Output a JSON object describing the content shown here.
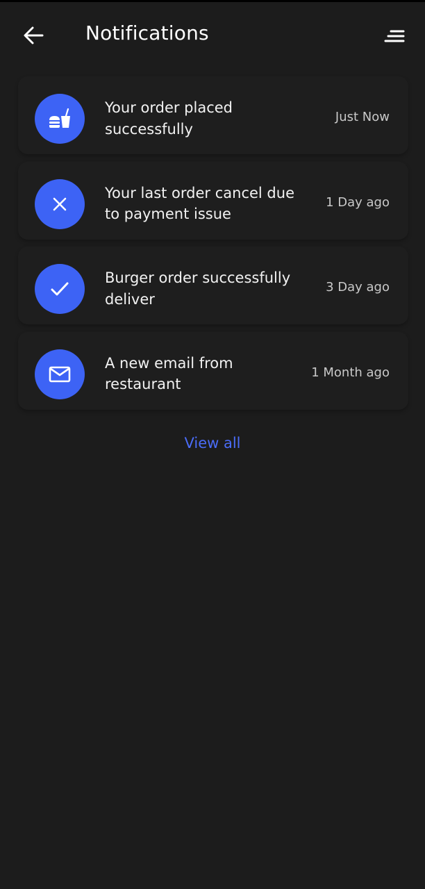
{
  "header": {
    "title": "Notifications",
    "back_icon": "arrow-left-icon",
    "filter_icon": "filter-lines-icon"
  },
  "notifications": [
    {
      "icon": "food-drink-icon",
      "message": "Your order placed successfully",
      "time": "Just Now"
    },
    {
      "icon": "close-icon",
      "message": "Your last order cancel due to payment issue",
      "time": "1 Day ago"
    },
    {
      "icon": "check-icon",
      "message": "Burger order successfully deliver",
      "time": "3 Day ago"
    },
    {
      "icon": "mail-icon",
      "message": "A new email from restaurant",
      "time": "1 Month ago"
    }
  ],
  "footer": {
    "view_all_label": "View all"
  },
  "colors": {
    "background": "#1c1c1c",
    "card": "#1e1e1e",
    "accent": "#3d63f5",
    "link": "#4a6cf7"
  }
}
